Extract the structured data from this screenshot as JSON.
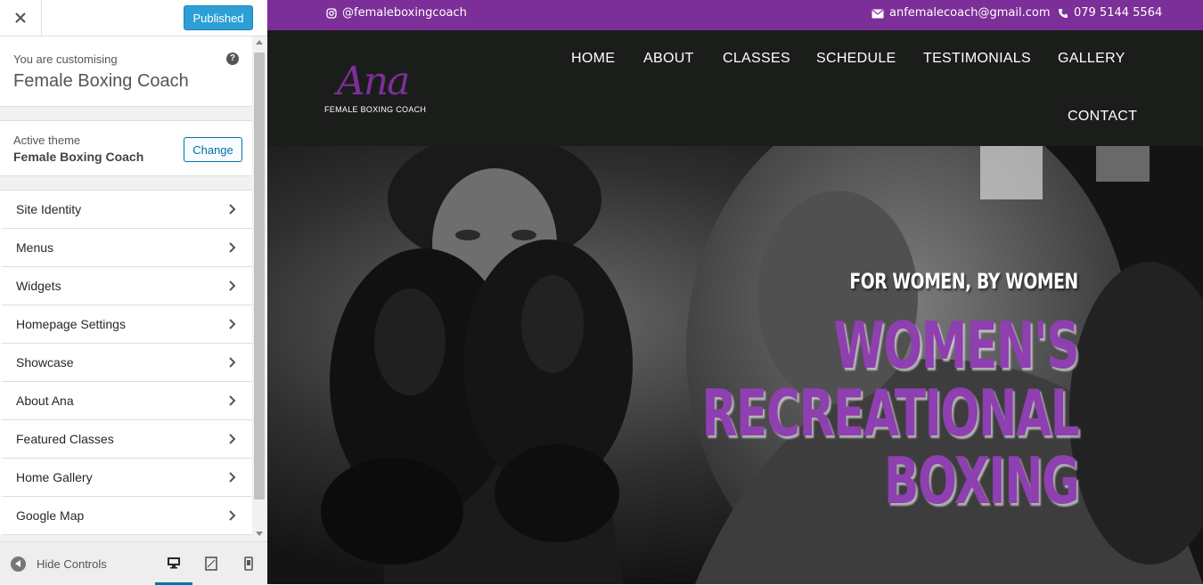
{
  "sidebar": {
    "publish_label": "Published",
    "info_pre": "You are customising",
    "info_title": "Female Boxing Coach",
    "help_icon": "?",
    "theme_pre": "Active theme",
    "theme_name": "Female Boxing Coach",
    "change_label": "Change",
    "items": [
      {
        "label": "Site Identity"
      },
      {
        "label": "Menus"
      },
      {
        "label": "Widgets"
      },
      {
        "label": "Homepage Settings"
      },
      {
        "label": "Showcase"
      },
      {
        "label": "About Ana"
      },
      {
        "label": "Featured Classes"
      },
      {
        "label": "Home Gallery"
      },
      {
        "label": "Google Map"
      }
    ],
    "hide_controls_label": "Hide Controls",
    "devices": [
      "desktop-icon",
      "tablet-icon",
      "mobile-icon"
    ]
  },
  "preview": {
    "topbar": {
      "instagram": "@femaleboxingcoach",
      "email": "anfemalecoach@gmail.com",
      "phone": "079 5144 5564"
    },
    "logo": {
      "script": "Ana",
      "sub": "FEMALE BOXING COACH"
    },
    "nav": {
      "home": "HOME",
      "about": "ABOUT",
      "classes": "CLASSES",
      "schedule": "SCHEDULE",
      "testimonials": "TESTIMONIALS",
      "gallery": "GALLERY",
      "contact": "CONTACT"
    },
    "hero": {
      "kicker": "FOR WOMEN, BY WOMEN",
      "title_1": "WOMEN'S",
      "title_2": "RECREATIONAL",
      "title_3": "BOXING"
    }
  },
  "colors": {
    "accent_purple": "#7c2f98",
    "publish_blue": "#2d9fd6",
    "link_blue": "#0073aa"
  }
}
